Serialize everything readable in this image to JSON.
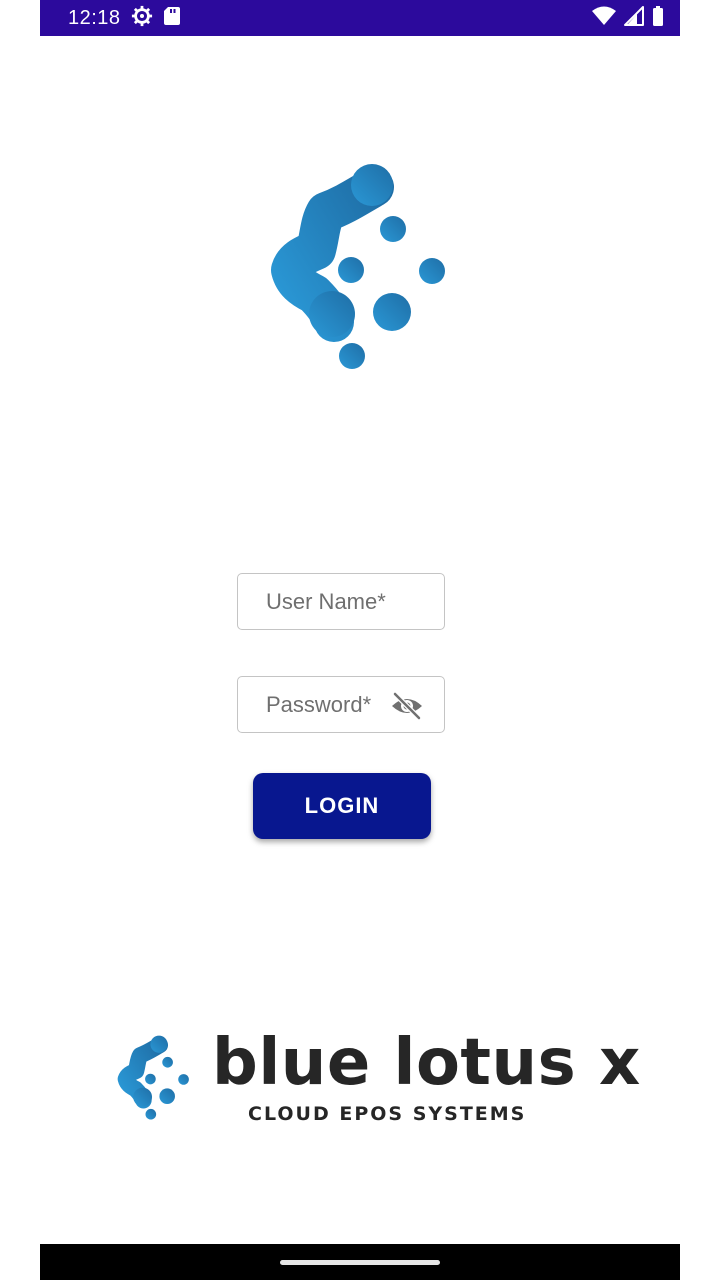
{
  "status_bar": {
    "time": "12:18",
    "left_icons": [
      "gear-icon",
      "sd-card-icon"
    ],
    "right_icons": [
      "wifi-icon",
      "signal-icon",
      "battery-icon"
    ],
    "background": "#2c0a9c"
  },
  "logo": {
    "icon": "blue-lotus-x-mark"
  },
  "login_form": {
    "username_placeholder": "User Name*",
    "username_value": "",
    "password_placeholder": "Password*",
    "password_value": "",
    "password_toggle_icon": "eye-off-icon",
    "login_label": "LOGIN"
  },
  "brand": {
    "name": "blue lotus x",
    "tagline": "CLOUD EPOS SYSTEMS"
  },
  "colors": {
    "accent_blue": "#2a8bc8",
    "button": "#08178f",
    "brand_text": "#262626"
  }
}
